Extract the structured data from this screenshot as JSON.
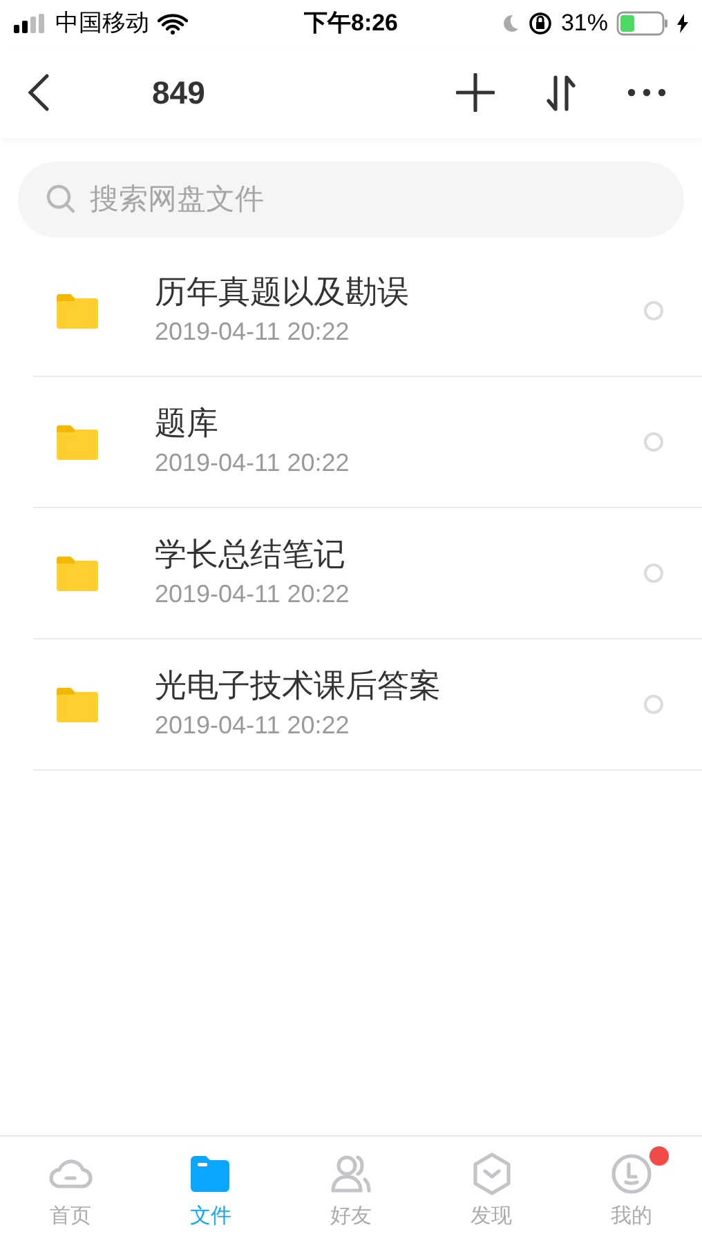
{
  "status_bar": {
    "carrier": "中国移动",
    "time": "下午8:26",
    "battery": "31%"
  },
  "nav": {
    "title": "849"
  },
  "search": {
    "placeholder": "搜索网盘文件"
  },
  "files": [
    {
      "name": "历年真题以及勘误",
      "date": "2019-04-11 20:22",
      "selected": false
    },
    {
      "name": "题库",
      "date": "2019-04-11 20:22",
      "selected": false
    },
    {
      "name": "学长总结笔记",
      "date": "2019-04-11 20:22",
      "selected": false
    },
    {
      "name": "光电子技术课后答案",
      "date": "2019-04-11 20:22",
      "selected": false
    }
  ],
  "tab_bar": [
    {
      "kind": "home",
      "label": "首页",
      "selected": false,
      "badge": false
    },
    {
      "kind": "files",
      "label": "文件",
      "selected": true,
      "badge": false
    },
    {
      "kind": "friends",
      "label": "好友",
      "selected": false,
      "badge": false
    },
    {
      "kind": "discover",
      "label": "发现",
      "selected": false,
      "badge": false
    },
    {
      "kind": "me",
      "label": "我的",
      "selected": false,
      "badge": true
    }
  ]
}
